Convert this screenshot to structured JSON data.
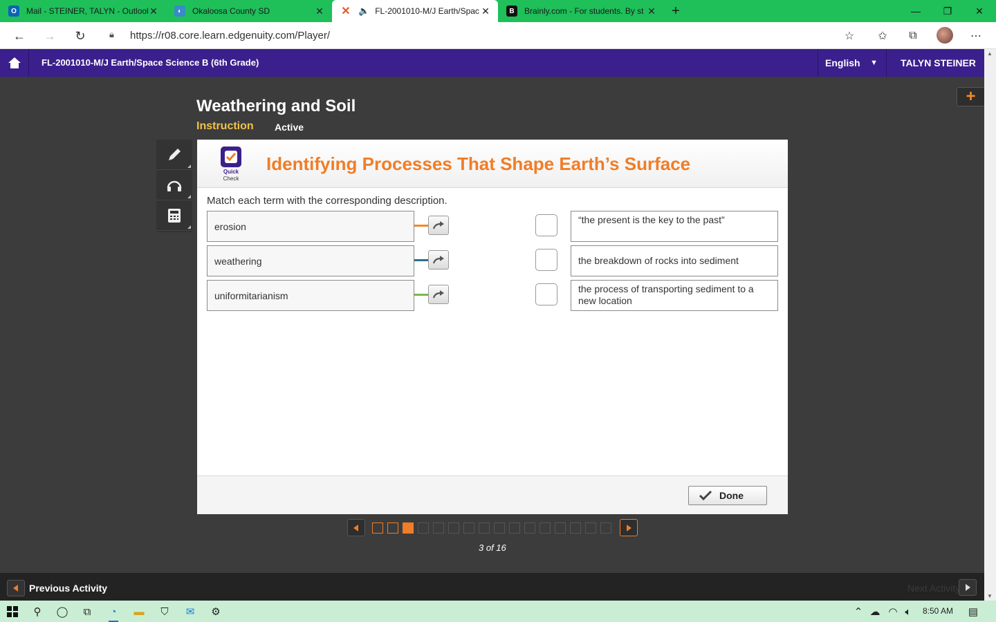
{
  "browser": {
    "tabs": [
      {
        "title": "Mail - STEINER, TALYN - Outlook",
        "icon": "outlook-icon",
        "color": "#0a64b4"
      },
      {
        "title": "Okaloosa County SD",
        "icon": "okaloosa-icon",
        "color": "#3a8ac9"
      },
      {
        "title": "FL-2001010-M/J Earth/Spac",
        "icon": "edgenuity-icon",
        "color": "#e05a2b"
      },
      {
        "title": "Brainly.com - For students. By st",
        "icon": "brainly-icon",
        "color": "#111111"
      }
    ],
    "url": "https://r08.core.learn.edgenuity.com/Player/"
  },
  "header": {
    "course": "FL-2001010-M/J Earth/Space Science B (6th Grade)",
    "language": "English",
    "user": "TALYN STEINER"
  },
  "lesson": {
    "title": "Weathering and Soil",
    "section": "Instruction",
    "status": "Active"
  },
  "activity": {
    "badge_line1": "Quick",
    "badge_line2": "Check",
    "title": "Identifying Processes That Shape Earth’s Surface",
    "prompt": "Match each term with the corresponding description.",
    "terms": [
      {
        "label": "erosion",
        "color": "#f08a24"
      },
      {
        "label": "weathering",
        "color": "#2a6f8a"
      },
      {
        "label": "uniformitarianism",
        "color": "#7ab648"
      }
    ],
    "descriptions": [
      "“the present is the key to the past”",
      "the breakdown of rocks into sediment",
      "the process of transporting sediment to a new location"
    ],
    "done_label": "Done"
  },
  "pager": {
    "total": 16,
    "current": 3,
    "label": "3 of 16"
  },
  "footer": {
    "previous": "Previous Activity",
    "next": "Next Activity"
  },
  "taskbar": {
    "time": "8:50 AM"
  }
}
